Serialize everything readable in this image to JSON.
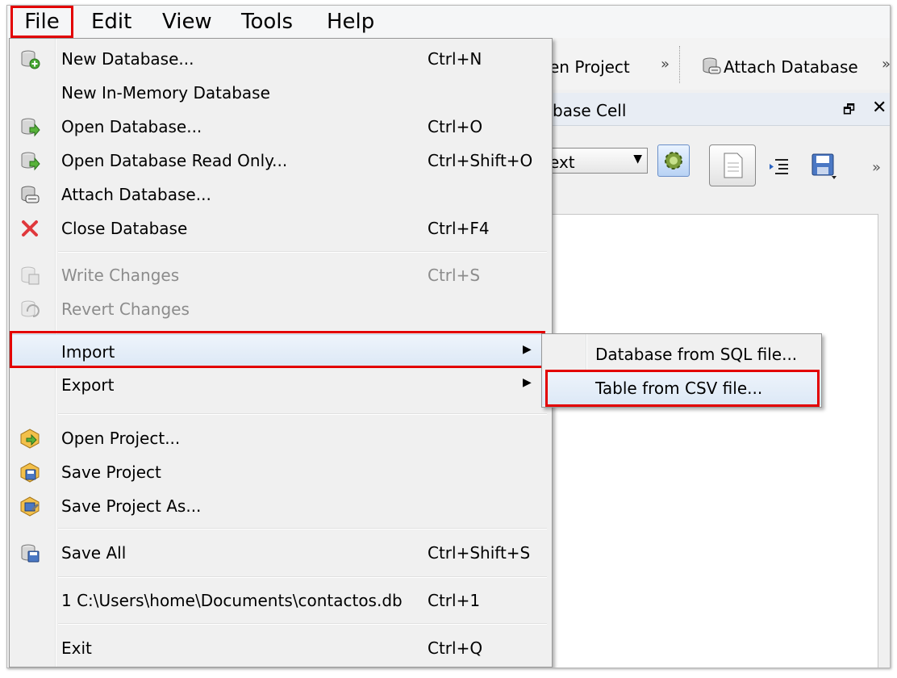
{
  "menubar": {
    "file": "File",
    "edit": "Edit",
    "view": "View",
    "tools": "Tools",
    "help": "Help"
  },
  "toolbar": {
    "open_project_partial": "en Project",
    "overflow": "»",
    "attach_database": "Attach Database"
  },
  "cell_panel": {
    "title_partial": "base Cell",
    "restore": "🗗",
    "close": "✕",
    "mode_partial": "ext",
    "mode_arrow": "▼",
    "overflow": "»"
  },
  "file_menu": {
    "new_database": {
      "label": "New Database...",
      "shortcut": "Ctrl+N"
    },
    "new_in_memory": {
      "label": "New In-Memory Database"
    },
    "open_database": {
      "label": "Open Database...",
      "shortcut": "Ctrl+O"
    },
    "open_read_only": {
      "label": "Open Database Read Only...",
      "shortcut": "Ctrl+Shift+O"
    },
    "attach_database": {
      "label": "Attach Database..."
    },
    "close_database": {
      "label": "Close Database",
      "shortcut": "Ctrl+F4"
    },
    "write_changes": {
      "label": "Write Changes",
      "shortcut": "Ctrl+S"
    },
    "revert_changes": {
      "label": "Revert Changes"
    },
    "import": {
      "label": "Import",
      "arrow": "▶"
    },
    "export": {
      "label": "Export",
      "arrow": "▶"
    },
    "open_project": {
      "label": "Open Project..."
    },
    "save_project": {
      "label": "Save Project"
    },
    "save_project_as": {
      "label": "Save Project As..."
    },
    "save_all": {
      "label": "Save All",
      "shortcut": "Ctrl+Shift+S"
    },
    "recent_1": {
      "label": "1 C:\\Users\\home\\Documents\\contactos.db",
      "shortcut": "Ctrl+1"
    },
    "exit": {
      "label": "Exit",
      "shortcut": "Ctrl+Q"
    }
  },
  "import_submenu": {
    "sql": "Database from SQL file...",
    "csv": "Table from CSV file..."
  },
  "colors": {
    "highlight_border": "#e30000",
    "menu_bg": "#f0f0f0",
    "hover_bg": "#dce8f6"
  }
}
